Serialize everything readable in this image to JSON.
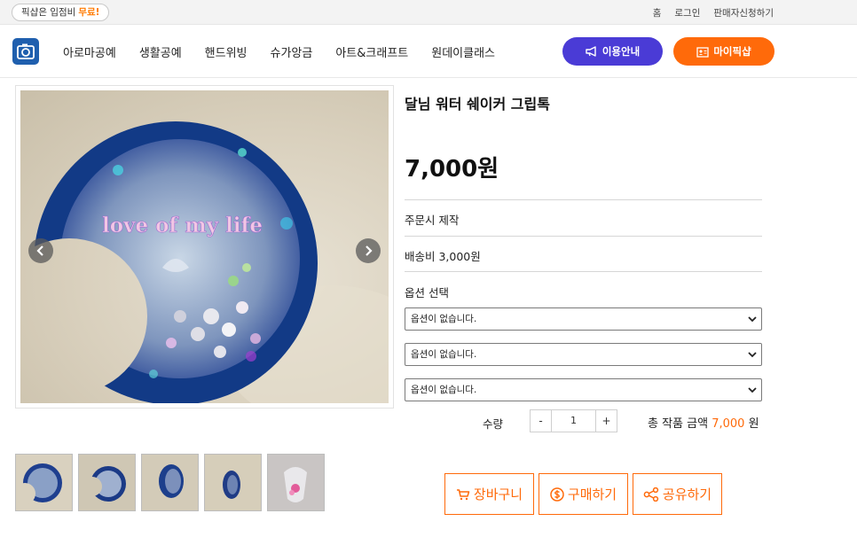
{
  "topbar": {
    "promo_prefix": "픽샵은 입점비",
    "promo_highlight": "무료!",
    "links": [
      "홈",
      "로그인",
      "판매자신청하기"
    ]
  },
  "header": {
    "nav": [
      "아로마공예",
      "생활공예",
      "핸드위빙",
      "슈가앙금",
      "아트&크래프트",
      "원데이클래스"
    ],
    "guide_label": "이용안내",
    "mypage_label": "마이픽샵"
  },
  "product": {
    "title": "달님 워터 쉐이커 그립톡",
    "price": "7,000원",
    "made_to_order": "주문시 제작",
    "shipping": "배송비 3,000원",
    "option_label": "옵션 선택",
    "options": [
      "옵션이 없습니다.",
      "옵션이 없습니다.",
      "옵션이 없습니다."
    ],
    "quantity_label": "수량",
    "quantity": "1",
    "total_prefix": "총 작품 금액",
    "total_amount": "7,000",
    "total_suffix": "원",
    "image_text": "love of my life"
  },
  "actions": {
    "cart": "장바구니",
    "buy": "구매하기",
    "share": "공유하기"
  },
  "colors": {
    "accent_orange": "#ff6a0a",
    "guide_purple": "#4a3bd6",
    "logo_blue": "#1f5fae"
  }
}
